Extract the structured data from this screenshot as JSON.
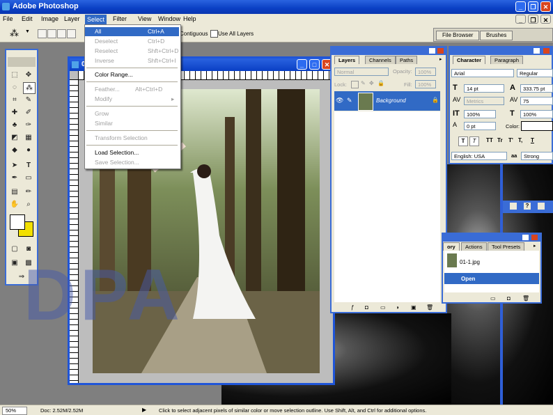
{
  "app": {
    "title": "Adobe Photoshop"
  },
  "menubar": [
    "File",
    "Edit",
    "Image",
    "Layer",
    "Select",
    "Filter",
    "View",
    "Window",
    "Help"
  ],
  "options": {
    "contiguous": "Contiguous",
    "use_all_layers": "Use All Layers",
    "file_browser": "File Browser",
    "brushes": "Brushes"
  },
  "select_menu": {
    "items": [
      {
        "label": "All",
        "shortcut": "Ctrl+A"
      },
      {
        "label": "Deselect",
        "shortcut": "Ctrl+D"
      },
      {
        "label": "Reselect",
        "shortcut": "Shft+Ctrl+D"
      },
      {
        "label": "Inverse",
        "shortcut": "Shft+Ctrl+I"
      },
      {
        "label": "Color Range..."
      },
      {
        "label": "Feather...",
        "shortcut": "Alt+Ctrl+D"
      },
      {
        "label": "Modify"
      },
      {
        "label": "Grow"
      },
      {
        "label": "Similar"
      },
      {
        "label": "Transform Selection"
      },
      {
        "label": "Load Selection..."
      },
      {
        "label": "Save Selection..."
      }
    ]
  },
  "document": {
    "title": "0"
  },
  "watermark": "DPA",
  "layers_panel": {
    "tabs": [
      "Layers",
      "Channels",
      "Paths"
    ],
    "blend_mode": "Normal",
    "opacity_label": "Opacity:",
    "opacity": "100%",
    "lock_label": "Lock:",
    "fill_label": "Fill:",
    "fill": "100%",
    "layer_name": "Background"
  },
  "character_panel": {
    "tabs": [
      "Character",
      "Paragraph"
    ],
    "font": "Arial",
    "style": "Regular",
    "size": "14 pt",
    "leading": "333.75 pt",
    "kerning": "Metrics",
    "tracking": "75",
    "vscale": "100%",
    "hscale": "100%",
    "baseline": "0 pt",
    "color_label": "Color:",
    "style_buttons": [
      "T",
      "T",
      "TT",
      "Tr",
      "T'",
      "T,",
      "T"
    ],
    "language": "English: USA",
    "aa_label": "aa",
    "antialias": "Strong"
  },
  "history_panel": {
    "tabs": [
      "ory",
      "Actions",
      "Tool Presets"
    ],
    "snapshot": "01-1.jpg",
    "step": "Open"
  },
  "status": {
    "zoom": "50%",
    "doc": "Doc: 2.52M/2.52M",
    "hint": "Click to select adjacent pixels of similar color or move selection outline.  Use Shift, Alt, and Ctrl for additional options."
  }
}
